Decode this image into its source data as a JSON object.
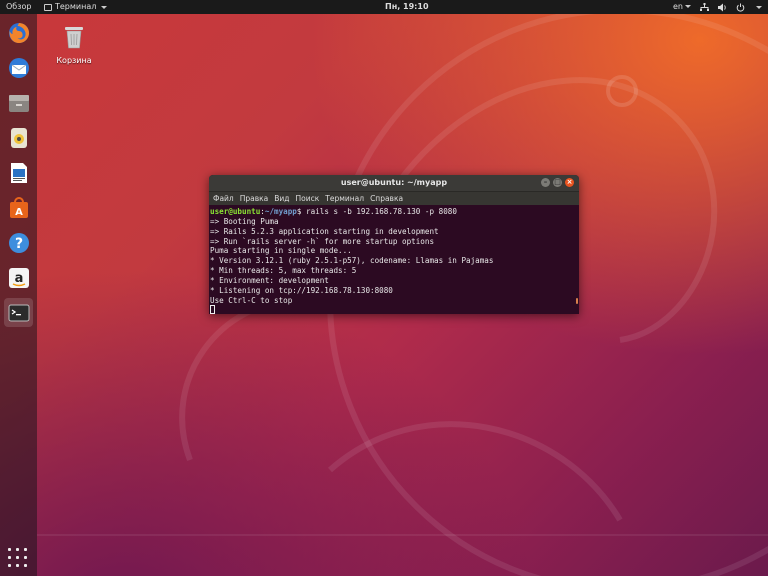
{
  "topbar": {
    "activities": "Обзор",
    "app_menu": "Терминал",
    "clock": "Пн, 19:10",
    "language": "en"
  },
  "dock": {
    "items": [
      {
        "icon": "firefox-icon"
      },
      {
        "icon": "thunderbird-icon"
      },
      {
        "icon": "files-icon"
      },
      {
        "icon": "rhythmbox-icon"
      },
      {
        "icon": "libreoffice-writer-icon"
      },
      {
        "icon": "software-center-icon"
      },
      {
        "icon": "help-icon"
      },
      {
        "icon": "amazon-icon"
      },
      {
        "icon": "terminal-icon",
        "active": true
      }
    ]
  },
  "desktop": {
    "trash_label": "Корзина"
  },
  "terminal": {
    "title": "user@ubuntu: ~/myapp",
    "menu": [
      "Файл",
      "Правка",
      "Вид",
      "Поиск",
      "Терминал",
      "Справка"
    ],
    "prompt_user": "user@ubuntu",
    "prompt_path": "~/myapp",
    "command": "rails s -b 192.168.78.130 -p 8080",
    "output": [
      "=> Booting Puma",
      "=> Rails 5.2.3 application starting in development",
      "=> Run `rails server -h` for more startup options",
      "Puma starting in single mode...",
      "* Version 3.12.1 (ruby 2.5.1-p57), codename: Llamas in Pajamas",
      "* Min threads: 5, max threads: 5",
      "* Environment: development",
      "* Listening on tcp://192.168.78.130:8080",
      "Use Ctrl-C to stop"
    ]
  },
  "colors": {
    "accent": "#e95420",
    "terminal_bg": "#2c0a22",
    "prompt_user": "#8ae234",
    "prompt_path": "#729fcf"
  }
}
